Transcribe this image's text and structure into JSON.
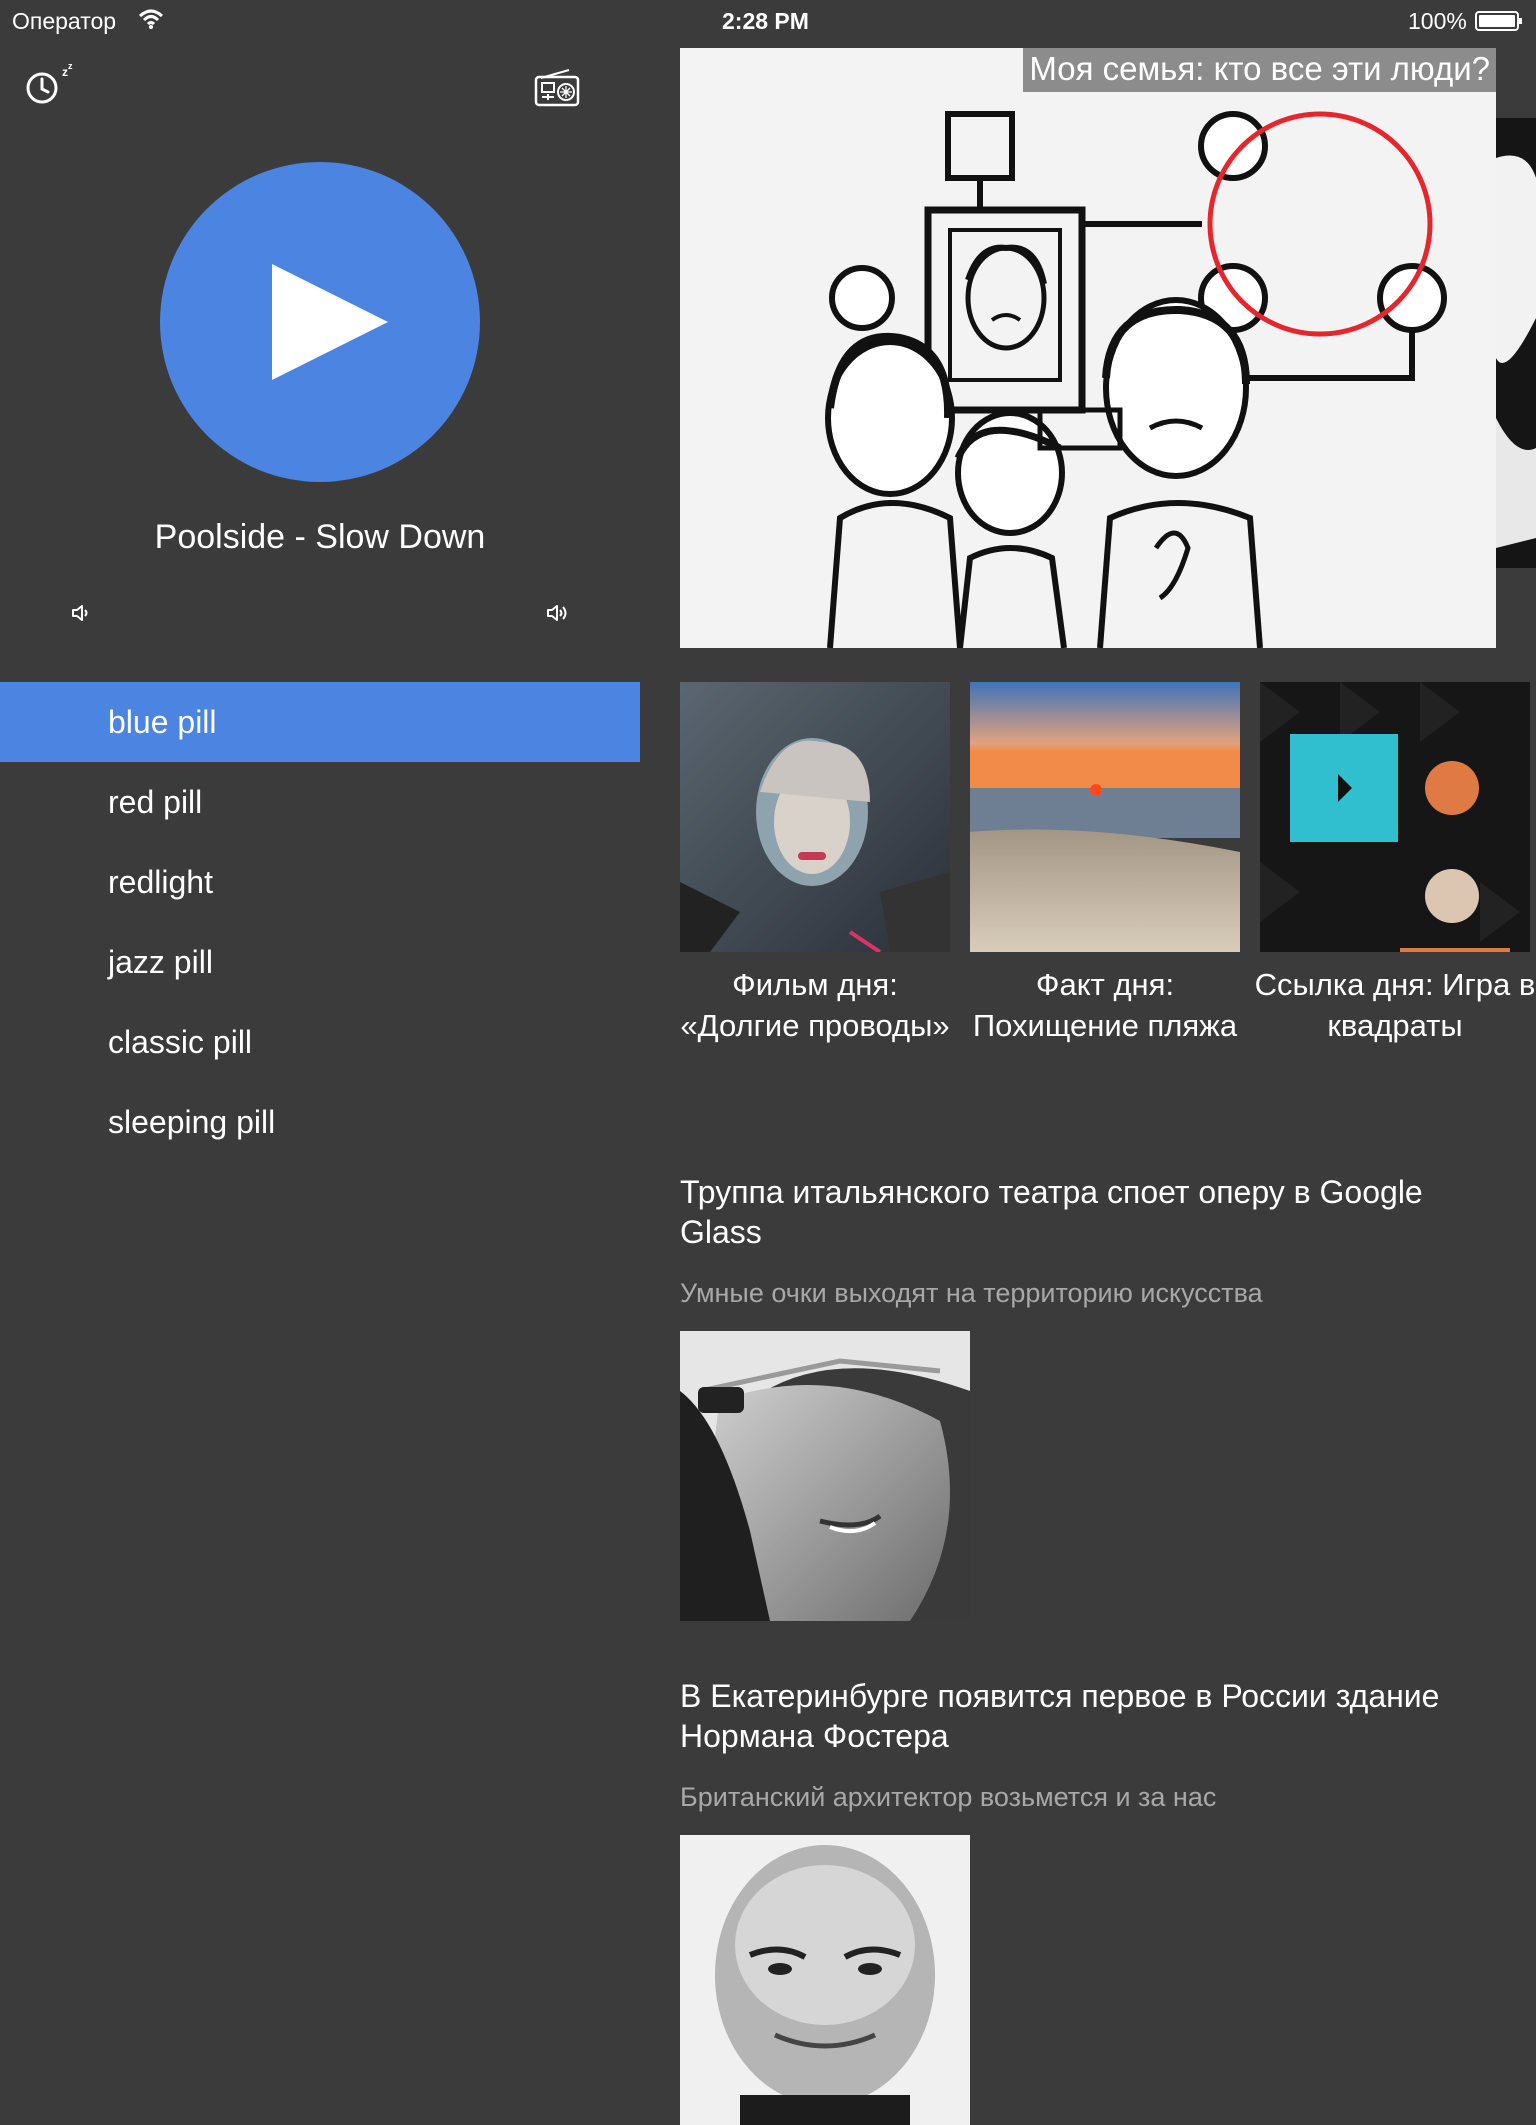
{
  "status_bar": {
    "carrier": "Оператор",
    "time": "2:28 PM",
    "battery": "100%"
  },
  "player": {
    "track": "Poolside - Slow Down",
    "accent_color": "#4c84e1"
  },
  "channels": [
    {
      "label": "blue pill",
      "active": true
    },
    {
      "label": "red pill",
      "active": false
    },
    {
      "label": "redlight",
      "active": false
    },
    {
      "label": "jazz pill",
      "active": false
    },
    {
      "label": "classic pill",
      "active": false
    },
    {
      "label": "sleeping pill",
      "active": false
    }
  ],
  "hero": {
    "title": "Моя семья: кто все эти люди?"
  },
  "tiles": [
    {
      "caption": "Фильм дня: «Долгие проводы»"
    },
    {
      "caption": "Факт дня: Похищение пляжа"
    },
    {
      "caption": "Ссылка дня: Игра в квадраты"
    }
  ],
  "articles": [
    {
      "title": "Труппа итальянского театра споет оперу в Google Glass",
      "subtitle": "Умные очки выходят на территорию искусства"
    },
    {
      "title": "В Екатеринбурге появится первое в России здание Нормана Фостера",
      "subtitle": "Британский архитектор возьмется и за нас"
    }
  ]
}
